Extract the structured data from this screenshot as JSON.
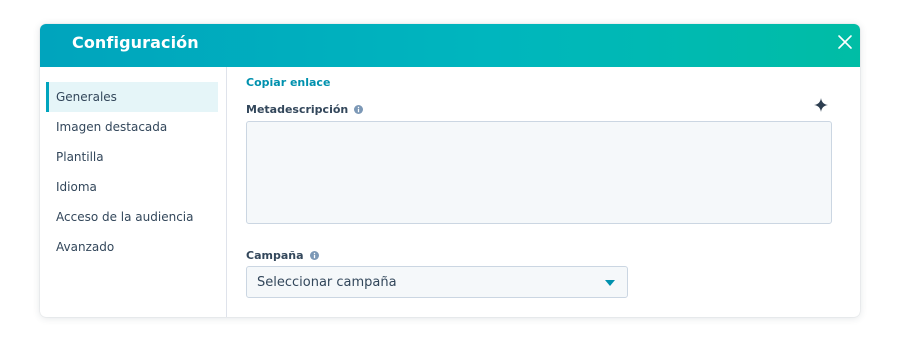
{
  "dialog": {
    "title": "Configuración",
    "close_icon": "close-icon"
  },
  "sidebar": {
    "items": [
      {
        "label": "Generales",
        "active": true
      },
      {
        "label": "Imagen destacada",
        "active": false
      },
      {
        "label": "Plantilla",
        "active": false
      },
      {
        "label": "Idioma",
        "active": false
      },
      {
        "label": "Acceso de la audiencia",
        "active": false
      },
      {
        "label": "Avanzado",
        "active": false
      }
    ]
  },
  "content": {
    "copy_link": "Copiar enlace",
    "meta_description": {
      "label": "Metadescripción",
      "info_icon": "info-icon",
      "ai_icon": "sparkle-icon",
      "value": ""
    },
    "campaign": {
      "label": "Campaña",
      "info_icon": "info-icon",
      "selected": "Seleccionar campaña",
      "caret_icon": "caret-down-icon"
    }
  },
  "colors": {
    "header_gradient_start": "#00a4bd",
    "header_gradient_end": "#00bda5",
    "link": "#0091ae",
    "active_bg": "#e5f5f8",
    "active_border": "#00a4bd",
    "text": "#33475b",
    "input_bg": "#f5f8fa",
    "input_border": "#cbd6e2"
  }
}
